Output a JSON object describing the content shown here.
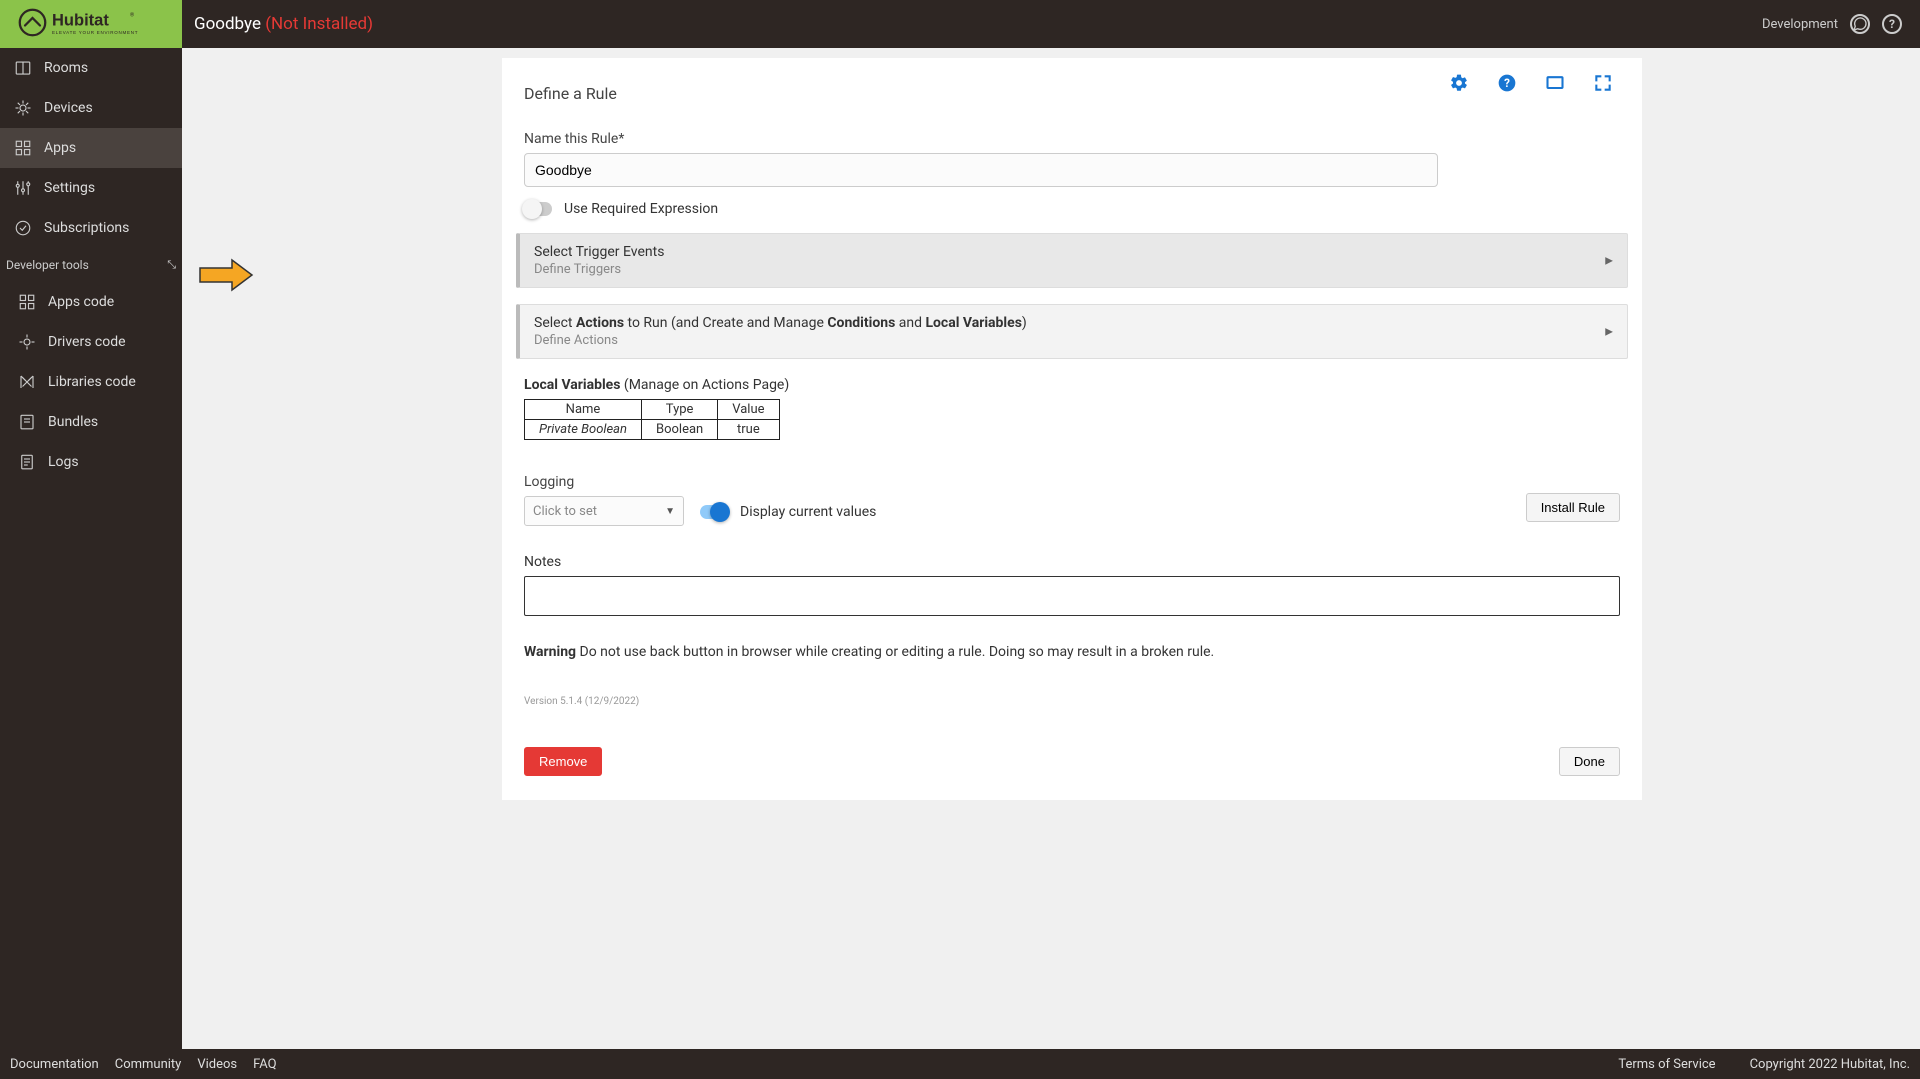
{
  "header": {
    "page_title": "Goodbye",
    "status": "(Not Installed)",
    "dev_label": "Development"
  },
  "sidebar": {
    "items": [
      {
        "label": "Rooms"
      },
      {
        "label": "Devices"
      },
      {
        "label": "Apps"
      },
      {
        "label": "Settings"
      },
      {
        "label": "Subscriptions"
      }
    ],
    "dev_section": "Developer tools",
    "dev_items": [
      {
        "label": "Apps code"
      },
      {
        "label": "Drivers code"
      },
      {
        "label": "Libraries code"
      },
      {
        "label": "Bundles"
      },
      {
        "label": "Logs"
      }
    ]
  },
  "main": {
    "section_title": "Define a Rule",
    "name_label": "Name this Rule*",
    "name_value": "Goodbye",
    "required_expr_label": "Use Required Expression",
    "triggers": {
      "title": "Select Trigger Events",
      "subtitle": "Define Triggers"
    },
    "actions": {
      "prefix": "Select ",
      "bold1": "Actions",
      "mid1": " to Run (and Create and Manage ",
      "bold2": "Conditions",
      "mid2": " and ",
      "bold3": "Local Variables",
      "suffix": ")",
      "subtitle": "Define Actions"
    },
    "local_vars": {
      "title": "Local Variables",
      "hint": " (Manage on Actions Page)",
      "headers": [
        "Name",
        "Type",
        "Value"
      ],
      "rows": [
        {
          "name": "Private Boolean",
          "type": "Boolean",
          "value": "true"
        }
      ]
    },
    "logging_label": "Logging",
    "logging_placeholder": "Click to set",
    "display_values_label": "Display current values",
    "install_btn": "Install Rule",
    "notes_label": "Notes",
    "warning_bold": "Warning",
    "warning_text": " Do not use back button in browser while creating or editing a rule. Doing so may result in a broken rule.",
    "version": "Version 5.1.4 (12/9/2022)",
    "remove_btn": "Remove",
    "done_btn": "Done"
  },
  "footer": {
    "links": [
      "Documentation",
      "Community",
      "Videos",
      "FAQ"
    ],
    "tos": "Terms of Service",
    "copyright": "Copyright 2022 Hubitat, Inc."
  }
}
